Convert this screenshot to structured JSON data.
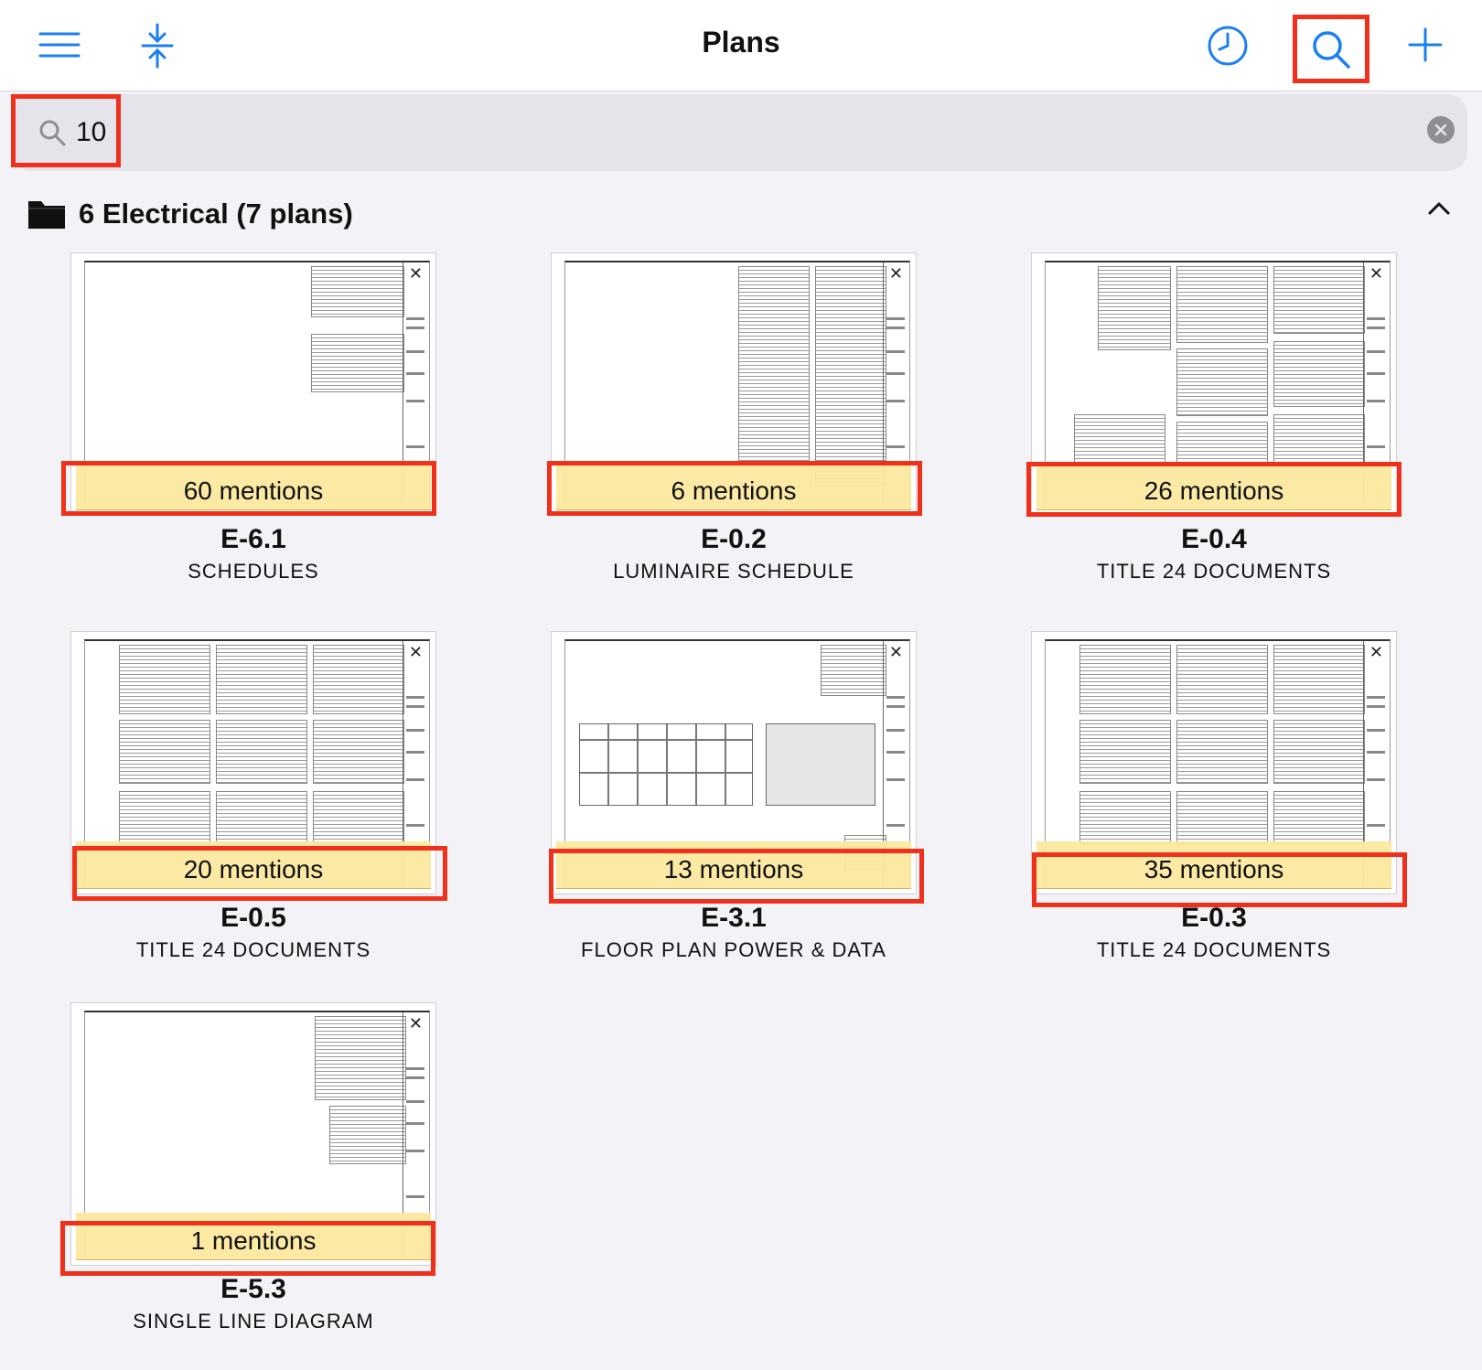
{
  "header": {
    "title": "Plans",
    "menu_icon": "hamburger-menu-icon",
    "collapse_icon": "collapse-arrows-icon",
    "history_icon": "clock-icon",
    "search_icon": "search-icon",
    "add_icon": "plus-icon"
  },
  "search": {
    "value": "10",
    "icon": "search-icon",
    "clear_icon": "clear-icon"
  },
  "section": {
    "title": "6 Electrical (7 plans)",
    "icon": "folder-icon",
    "toggle_icon": "chevron-up-icon"
  },
  "plans": [
    {
      "id": "E-6.1",
      "name": "SCHEDULES",
      "mentions": "60 mentions"
    },
    {
      "id": "E-0.2",
      "name": "LUMINAIRE SCHEDULE",
      "mentions": "6 mentions"
    },
    {
      "id": "E-0.4",
      "name": "TITLE 24 DOCUMENTS",
      "mentions": "26 mentions"
    },
    {
      "id": "E-0.5",
      "name": "TITLE 24 DOCUMENTS",
      "mentions": "20 mentions"
    },
    {
      "id": "E-3.1",
      "name": "FLOOR PLAN POWER & DATA",
      "mentions": "13 mentions"
    },
    {
      "id": "E-0.3",
      "name": "TITLE 24 DOCUMENTS",
      "mentions": "35 mentions"
    },
    {
      "id": "E-5.3",
      "name": "SINGLE LINE DIAGRAM",
      "mentions": "1 mentions"
    }
  ],
  "colors": {
    "accent": "#1b7ff0",
    "highlight_box": "#f0301a",
    "mention_bg": "#fbe8a0",
    "background": "#f2f2f7"
  }
}
